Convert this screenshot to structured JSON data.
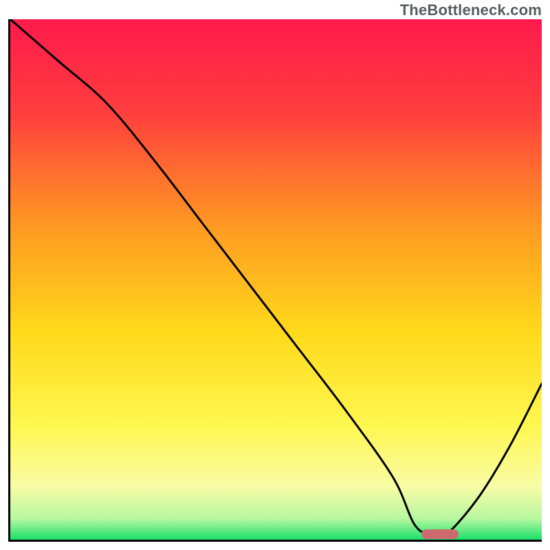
{
  "watermark": "TheBottleneck.com",
  "colors": {
    "axis": "#000000",
    "curve": "#000000",
    "marker": "#cc6a6e",
    "gradient_stops": [
      {
        "offset": 0.0,
        "color": "#ff1a4b"
      },
      {
        "offset": 0.18,
        "color": "#ff3e3e"
      },
      {
        "offset": 0.4,
        "color": "#ff9a22"
      },
      {
        "offset": 0.6,
        "color": "#ffd91a"
      },
      {
        "offset": 0.78,
        "color": "#fff750"
      },
      {
        "offset": 0.9,
        "color": "#f8fca6"
      },
      {
        "offset": 0.96,
        "color": "#b6f7a0"
      },
      {
        "offset": 1.0,
        "color": "#19e06b"
      }
    ]
  },
  "chart_data": {
    "type": "line",
    "title": "",
    "xlabel": "",
    "ylabel": "",
    "xlim": [
      0,
      100
    ],
    "ylim": [
      0,
      100
    ],
    "x": [
      0,
      9,
      18,
      27,
      36,
      45,
      54,
      63,
      72,
      76,
      79,
      82,
      88,
      94,
      100
    ],
    "values": [
      100,
      92,
      84,
      73,
      61,
      49,
      37,
      25,
      12,
      3,
      1,
      1,
      8,
      18,
      30
    ],
    "marker": {
      "x_start": 77,
      "x_end": 84,
      "y": 1
    },
    "annotations": []
  }
}
